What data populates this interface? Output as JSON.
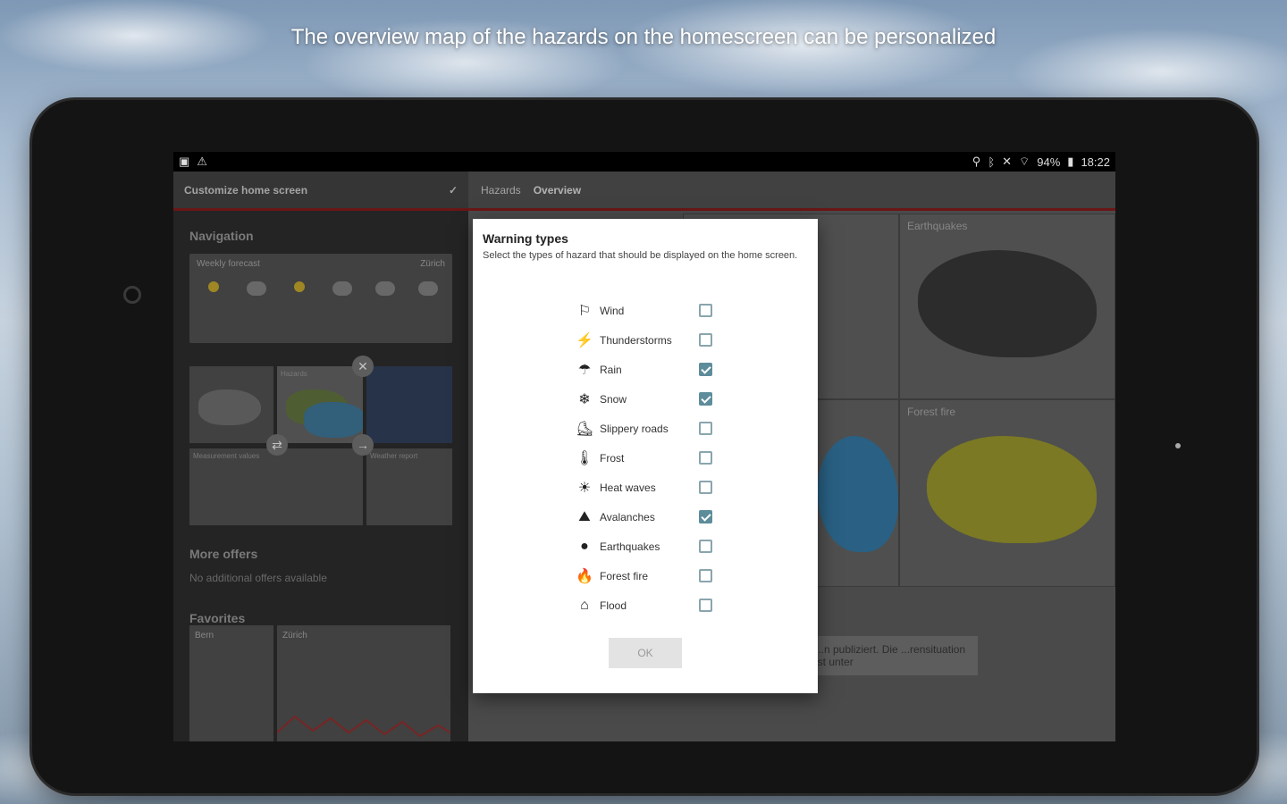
{
  "headline": "The overview map of the hazards on the homescreen can be personalized",
  "statusbar": {
    "battery": "94%",
    "time": "18:22"
  },
  "left": {
    "header_title": "Customize home screen",
    "navigation_title": "Navigation",
    "weekly_title": "Weekly forecast",
    "weekly_location": "Zürich",
    "hazards_tile": "Hazards",
    "measurement_tile": "Measurement values",
    "weather_report_tile": "Weather report",
    "more_offers_title": "More offers",
    "more_offers_text": "No additional offers available",
    "favorites_title": "Favorites",
    "fav1": "Bern",
    "fav2": "Zürich"
  },
  "right": {
    "tab_hazards": "Hazards",
    "tab_overview": "Overview",
    "tile_earthquakes": "Earthquakes",
    "tile_forest_fire": "Forest fire",
    "bottom_text": "...n publiziert. Die ...rensituation ist unter"
  },
  "dialog": {
    "title": "Warning types",
    "description": "Select the types of hazard that should be displayed on the home screen.",
    "ok_label": "OK",
    "options": [
      {
        "label": "Wind",
        "icon": "wind-icon",
        "glyph": "⚐",
        "checked": false
      },
      {
        "label": "Thunderstorms",
        "icon": "thunderstorm-icon",
        "glyph": "⚡",
        "checked": false
      },
      {
        "label": "Rain",
        "icon": "rain-icon",
        "glyph": "☂",
        "checked": true
      },
      {
        "label": "Snow",
        "icon": "snow-icon",
        "glyph": "❄",
        "checked": true
      },
      {
        "label": "Slippery roads",
        "icon": "slippery-roads-icon",
        "glyph": "⛸",
        "checked": false
      },
      {
        "label": "Frost",
        "icon": "frost-icon",
        "glyph": "🌡",
        "checked": false
      },
      {
        "label": "Heat waves",
        "icon": "heat-waves-icon",
        "glyph": "☀",
        "checked": false
      },
      {
        "label": "Avalanches",
        "icon": "avalanche-icon",
        "glyph": "⛰",
        "checked": true
      },
      {
        "label": "Earthquakes",
        "icon": "earthquake-icon",
        "glyph": "●",
        "checked": false
      },
      {
        "label": "Forest fire",
        "icon": "forest-fire-icon",
        "glyph": "🔥",
        "checked": false
      },
      {
        "label": "Flood",
        "icon": "flood-icon",
        "glyph": "⌂",
        "checked": false
      }
    ]
  },
  "colors": {
    "accent": "#5d8c9b",
    "header_line": "#7a1a1a"
  }
}
